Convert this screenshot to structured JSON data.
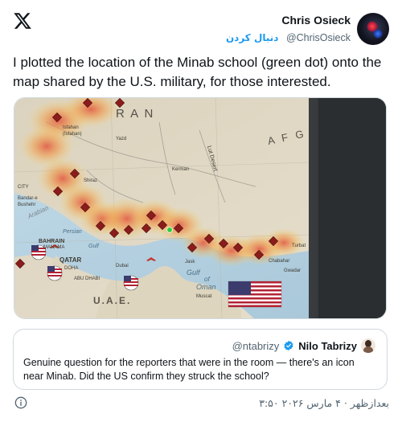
{
  "author": {
    "name": "Chris Osieck",
    "handle": "@ChrisOsieck",
    "follow_label": "دنبال کردن"
  },
  "tweet": {
    "text": "I plotted the location of the Minab school (green dot) onto the map shared by the U.S. military, for those interested."
  },
  "map": {
    "labels": {
      "iran": "R A N",
      "afg": "A F G",
      "isfahan": "Isfahan",
      "isfahan_alt": "(Isfahan)",
      "yazd": "Yazd",
      "kerman": "Kerman",
      "lut": "Lut Desert",
      "shiraz": "Shiraz",
      "bandar": "Bandar-e",
      "bushehr": "Bushehr",
      "city": "CITY",
      "bahrain": "BAHRAIN",
      "manama": "MANAMA",
      "qatar": "QATAR",
      "doha": "DOHA",
      "abu_dhabi": "ABU DHABI",
      "dubai": "Dubai",
      "uae": "U.A.E.",
      "gulf": "Gulf",
      "persian": "Persian",
      "arabian": "Arabian",
      "jask": "Jask",
      "chabahar": "Chabahar",
      "gwadar": "Gwadar",
      "turbat": "Turbat",
      "gulf_of": "Gulf",
      "of_label": "of",
      "oman": "Oman",
      "muscat": "Muscat"
    },
    "minab_marker_color": "#2ecc40",
    "strike_marker_color": "#8b1c1c"
  },
  "quote": {
    "handle": "@ntabrizy",
    "name": "Nilo Tabrizy",
    "text": "Genuine question for the reporters that were in the room — there's an icon near Minab. Did the US confirm they struck the school?"
  },
  "footer": {
    "timestamp": "۳:۵۰ بعدازظهر · ۴ مارس ۲۰۲۶"
  },
  "colors": {
    "accent": "#1d9bf0",
    "text": "#0f1419",
    "secondary": "#536471",
    "border": "#cfd9de"
  }
}
